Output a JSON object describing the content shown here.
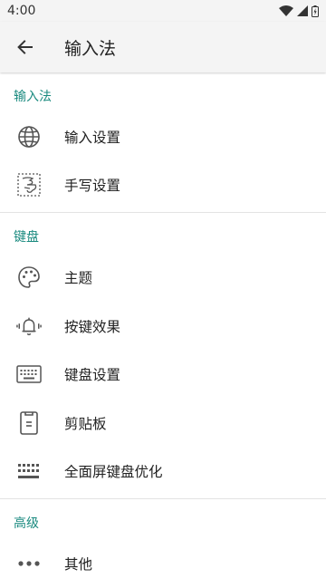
{
  "status_bar": {
    "time": "4:00"
  },
  "app_bar": {
    "title": "输入法"
  },
  "sections": [
    {
      "header": "输入法",
      "items": [
        {
          "label": "输入设置",
          "icon": "globe-icon"
        },
        {
          "label": "手写设置",
          "icon": "handwriting-icon"
        }
      ]
    },
    {
      "header": "键盘",
      "items": [
        {
          "label": "主题",
          "icon": "palette-icon"
        },
        {
          "label": "按键效果",
          "icon": "bell-vibrate-icon"
        },
        {
          "label": "键盘设置",
          "icon": "keyboard-icon"
        },
        {
          "label": "剪贴板",
          "icon": "clipboard-icon"
        },
        {
          "label": "全面屏键盘优化",
          "icon": "keyboard-grid-icon"
        }
      ]
    },
    {
      "header": "高级",
      "items": [
        {
          "label": "其他",
          "icon": "more-icon"
        }
      ]
    }
  ],
  "colors": {
    "accent": "#1a8a7f",
    "bar": "#f4f4f4"
  }
}
